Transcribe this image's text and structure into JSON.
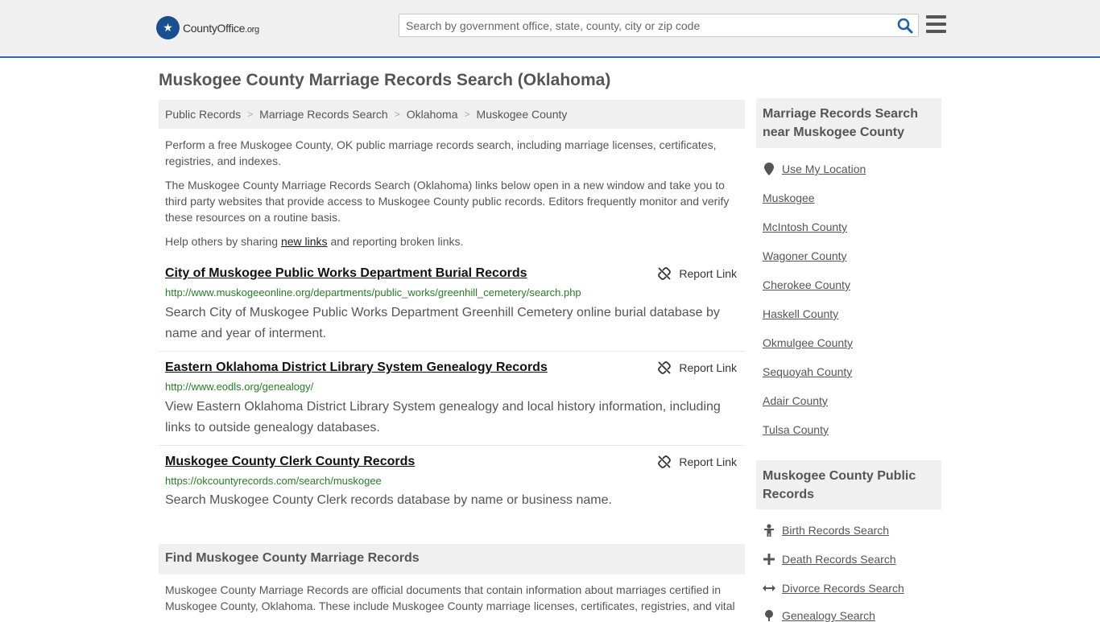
{
  "header": {
    "logo_name": "CountyOffice",
    "logo_tld": ".org",
    "search_placeholder": "Search by government office, state, county, city or zip code"
  },
  "page_title": "Muskogee County Marriage Records Search (Oklahoma)",
  "breadcrumb": [
    "Public Records",
    "Marriage Records Search",
    "Oklahoma",
    "Muskogee County"
  ],
  "intro": {
    "p1": "Perform a free Muskogee County, OK public marriage records search, including marriage licenses, certificates, registries, and indexes.",
    "p2": "The Muskogee County Marriage Records Search (Oklahoma) links below open in a new window and take you to third party websites that provide access to Muskogee County public records. Editors frequently monitor and verify these resources on a routine basis.",
    "p3_before": "Help others by sharing ",
    "p3_link": "new links",
    "p3_after": " and reporting broken links."
  },
  "report_label": "Report Link",
  "records": [
    {
      "title": "City of Muskogee Public Works Department Burial Records",
      "url": "http://www.muskogeeonline.org/departments/public_works/greenhill_cemetery/search.php",
      "desc": "Search City of Muskogee Public Works Department Greenhill Cemetery online burial database by name and year of interment."
    },
    {
      "title": "Eastern Oklahoma District Library System Genealogy Records",
      "url": "http://www.eodls.org/genealogy/",
      "desc": "View Eastern Oklahoma District Library System genealogy and local history information, including links to outside genealogy databases."
    },
    {
      "title": "Muskogee County Clerk County Records",
      "url": "https://okcountyrecords.com/search/muskogee",
      "desc": "Search Muskogee County Clerk records database by name or business name."
    }
  ],
  "find": {
    "heading": "Find Muskogee County Marriage Records",
    "text": "Muskogee County Marriage Records are official documents that contain information about marriages certified in Muskogee County, Oklahoma. These include Muskogee County marriage licenses, certificates, registries, and vital"
  },
  "sidebar": {
    "nearby_heading": "Marriage Records Search near Muskogee County",
    "use_location": "Use My Location",
    "nearby": [
      "Muskogee",
      "McIntosh County",
      "Wagoner County",
      "Cherokee County",
      "Haskell County",
      "Okmulgee County",
      "Sequoyah County",
      "Adair County",
      "Tulsa County"
    ],
    "public_heading": "Muskogee County Public Records",
    "public_links": [
      "Birth Records Search",
      "Death Records Search",
      "Divorce Records Search",
      "Genealogy Search"
    ]
  },
  "colors": {
    "link_green": "#2a7a2a",
    "header_border": "#2b6cb0",
    "logo_blue": "#1a4f8f",
    "search_icon": "#1f5fa8"
  }
}
